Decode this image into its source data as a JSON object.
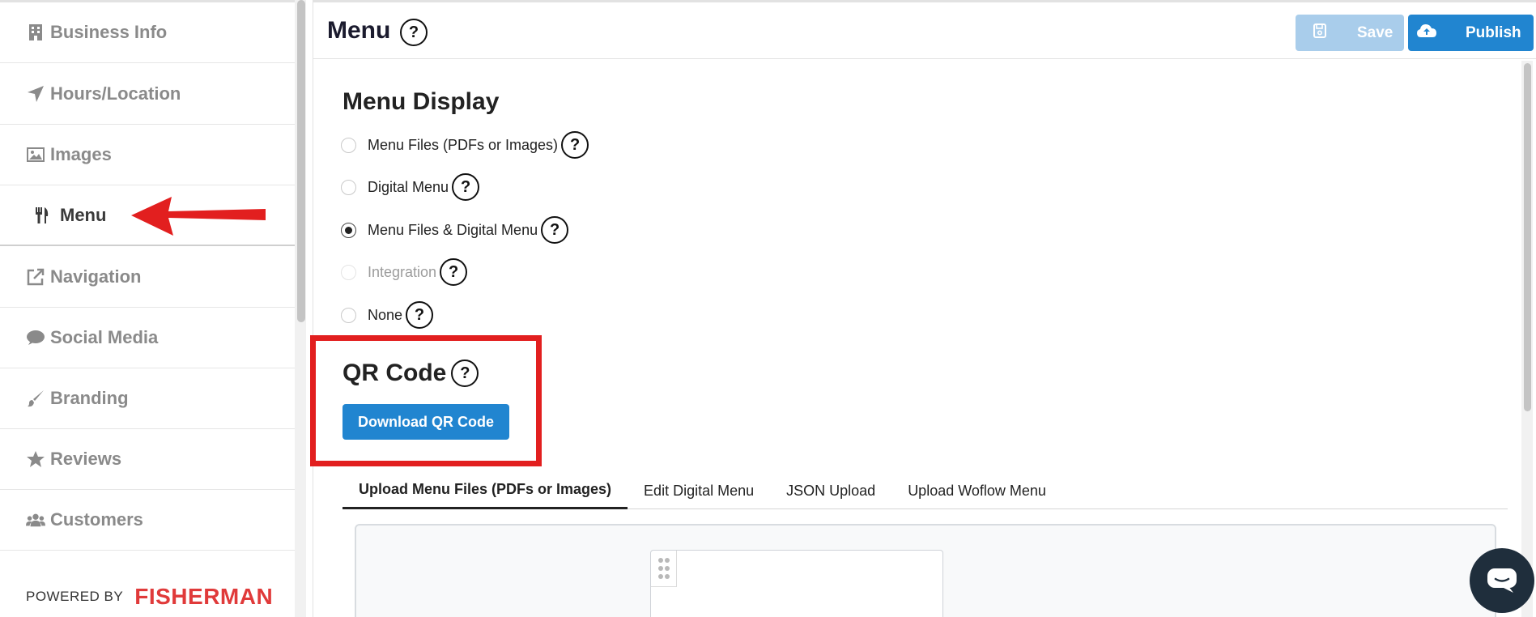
{
  "sidebar": {
    "items": [
      {
        "label": "Business Info",
        "icon": "building-icon"
      },
      {
        "label": "Hours/Location",
        "icon": "location-arrow-icon"
      },
      {
        "label": "Images",
        "icon": "image-icon"
      },
      {
        "label": "Menu",
        "icon": "utensils-icon",
        "active": true
      },
      {
        "label": "Navigation",
        "icon": "external-link-icon"
      },
      {
        "label": "Social Media",
        "icon": "comment-icon"
      },
      {
        "label": "Branding",
        "icon": "paint-brush-icon"
      },
      {
        "label": "Reviews",
        "icon": "star-icon"
      },
      {
        "label": "Customers",
        "icon": "users-icon"
      }
    ],
    "powered_by": "POWERED BY",
    "brand": "FISHERMAN"
  },
  "header": {
    "title": "Menu",
    "save_label": "Save",
    "publish_label": "Publish"
  },
  "menu_display": {
    "title": "Menu Display",
    "options": [
      {
        "label": "Menu Files (PDFs or Images)",
        "checked": false,
        "disabled": false
      },
      {
        "label": "Digital Menu",
        "checked": false,
        "disabled": false
      },
      {
        "label": "Menu Files & Digital Menu",
        "checked": true,
        "disabled": false
      },
      {
        "label": "Integration",
        "checked": false,
        "disabled": true
      },
      {
        "label": "None",
        "checked": false,
        "disabled": false
      }
    ]
  },
  "qr_code": {
    "title": "QR Code",
    "download_label": "Download QR Code"
  },
  "tabs": [
    {
      "label": "Upload Menu Files (PDFs or Images)",
      "active": true
    },
    {
      "label": "Edit Digital Menu",
      "active": false
    },
    {
      "label": "JSON Upload",
      "active": false
    },
    {
      "label": "Upload Woflow Menu",
      "active": false
    }
  ],
  "help_symbol": "?",
  "colors": {
    "primary": "#2185d0",
    "primary_disabled": "#a9cdeb",
    "annotation_red": "#e21f1f",
    "brand_red": "#e03a3a",
    "chat": "#1f2e3c"
  }
}
